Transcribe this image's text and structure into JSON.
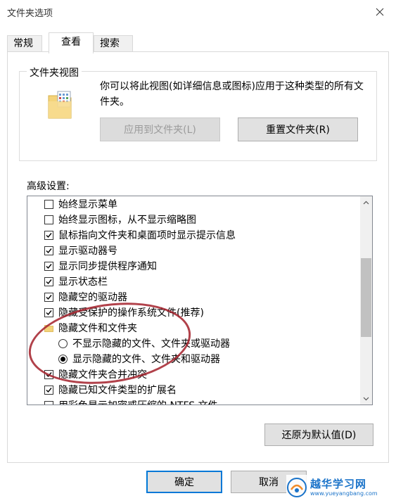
{
  "window": {
    "title": "文件夹选项"
  },
  "tabs": [
    {
      "label": "常规"
    },
    {
      "label": "查看"
    },
    {
      "label": "搜索"
    }
  ],
  "folder_views": {
    "group_label": "文件夹视图",
    "description": "你可以将此视图(如详细信息或图标)应用于这种类型的所有文件夹。",
    "apply_button": "应用到文件夹(L)",
    "reset_button": "重置文件夹(R)"
  },
  "advanced": {
    "label": "高级设置:",
    "items": [
      {
        "type": "checkbox",
        "checked": false,
        "label": "始终显示菜单"
      },
      {
        "type": "checkbox",
        "checked": false,
        "label": "始终显示图标，从不显示缩略图"
      },
      {
        "type": "checkbox",
        "checked": true,
        "label": "鼠标指向文件夹和桌面项时显示提示信息"
      },
      {
        "type": "checkbox",
        "checked": true,
        "label": "显示驱动器号"
      },
      {
        "type": "checkbox",
        "checked": true,
        "label": "显示同步提供程序通知"
      },
      {
        "type": "checkbox",
        "checked": true,
        "label": "显示状态栏"
      },
      {
        "type": "checkbox",
        "checked": true,
        "label": "隐藏空的驱动器"
      },
      {
        "type": "checkbox",
        "checked": true,
        "label": "隐藏受保护的操作系统文件(推荐)"
      },
      {
        "type": "folder",
        "label": "隐藏文件和文件夹"
      },
      {
        "type": "radio",
        "checked": false,
        "label": "不显示隐藏的文件、文件夹或驱动器"
      },
      {
        "type": "radio",
        "checked": true,
        "label": "显示隐藏的文件、文件夹和驱动器"
      },
      {
        "type": "checkbox",
        "checked": true,
        "label": "隐藏文件夹合并冲突"
      },
      {
        "type": "checkbox",
        "checked": true,
        "label": "隐藏已知文件类型的扩展名"
      },
      {
        "type": "checkbox",
        "checked": false,
        "label": "用彩色显示加密或压缩的 NTFS 文件"
      }
    ],
    "restore_button": "还原为默认值(D)"
  },
  "footer": {
    "ok_button": "确定",
    "cancel_button": "取消"
  },
  "watermark": {
    "name": "越华学习网",
    "url": "www.yueyangbang.com"
  }
}
